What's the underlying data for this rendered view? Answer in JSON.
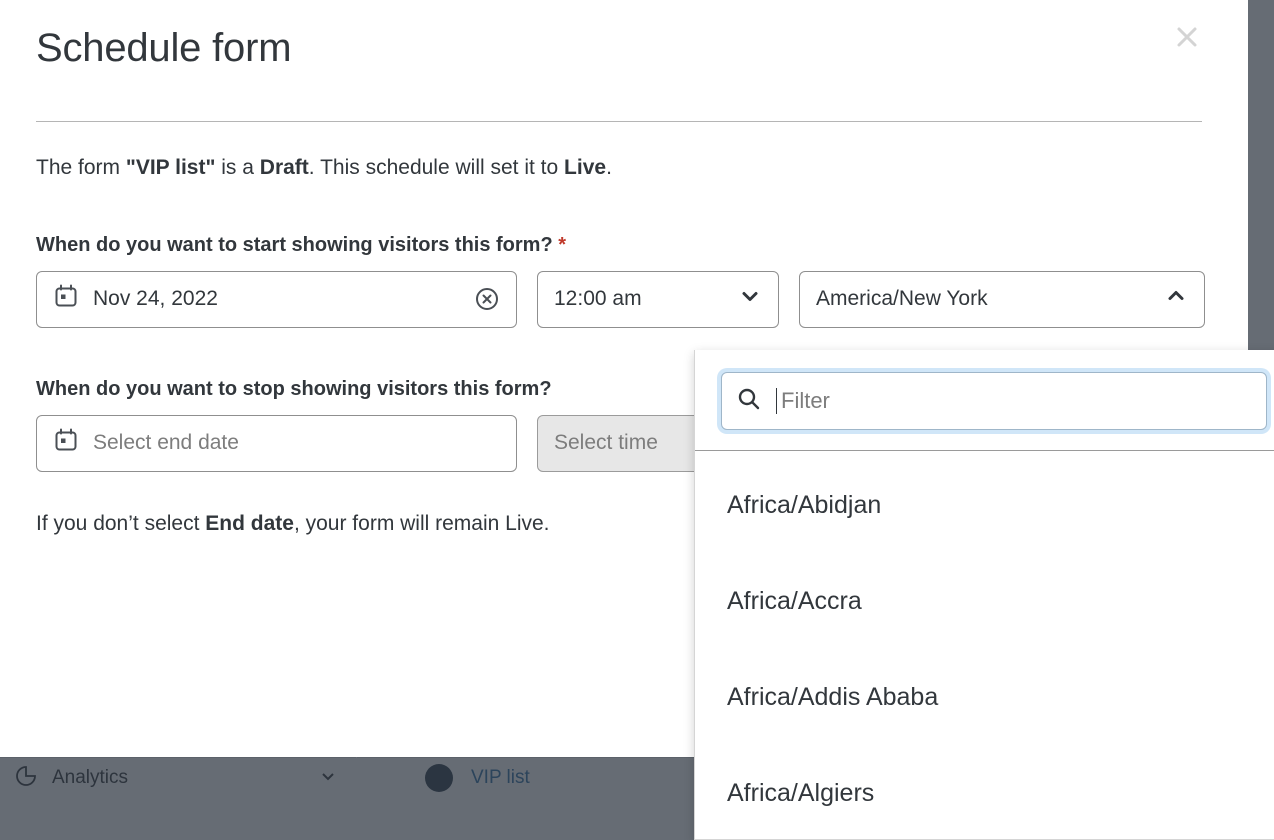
{
  "background": {
    "sidebar": {
      "items": [
        {
          "label": "Analytics",
          "icon": "analytics-pie-icon",
          "chevron": "chevron-down-icon"
        }
      ]
    },
    "content": {
      "rows": [
        {
          "avatar": "form-avatar",
          "link": "VIP list"
        }
      ]
    }
  },
  "modal": {
    "title": "Schedule form",
    "close_icon": "close-icon",
    "intro": {
      "prefix": "The form ",
      "form_name": "\"VIP list\"",
      "mid1": " is a ",
      "status_from": "Draft",
      "mid2": ". This schedule will set it to ",
      "status_to": "Live",
      "suffix": "."
    },
    "start": {
      "label": "When do you want to start showing visitors this form?",
      "required_marker": "*",
      "date": {
        "icon": "calendar-icon",
        "value": "Nov 24, 2022",
        "clear_icon": "clear-circle-icon"
      },
      "time": {
        "value": "12:00 am",
        "chevron": "chevron-down-icon"
      },
      "timezone": {
        "value": "America/New York",
        "chevron": "chevron-up-icon"
      }
    },
    "end": {
      "label": "When do you want to stop showing visitors this form?",
      "date": {
        "icon": "calendar-icon",
        "placeholder": "Select end date"
      },
      "time": {
        "placeholder": "Select time",
        "disabled": true
      }
    },
    "helper": {
      "prefix": "If you don’t select ",
      "bold": "End date",
      "suffix": ", your form will remain Live."
    }
  },
  "timezone_dropdown": {
    "search": {
      "icon": "search-icon",
      "placeholder": "Filter",
      "value": ""
    },
    "options": [
      "Africa/Abidjan",
      "Africa/Accra",
      "Africa/Addis Ababa",
      "Africa/Algiers"
    ]
  },
  "colors": {
    "accent_link": "#2f6fa6",
    "required": "#c0392b",
    "text": "#32373c",
    "overlay": "#2b333f",
    "focus_ring": "#96c8f0"
  }
}
